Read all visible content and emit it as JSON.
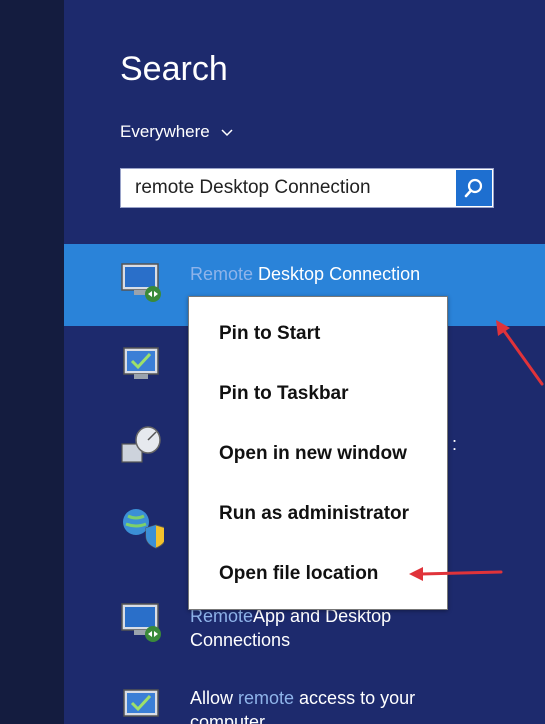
{
  "search": {
    "title": "Search",
    "scope": "Everywhere",
    "query": "remote Desktop Connection"
  },
  "results": [
    {
      "prefix": "Remote",
      "rest": " Desktop Connection",
      "icon": "remote-desktop-icon"
    },
    {
      "line1_highlight": "Remote",
      "line1_rest": "App and Desktop",
      "line2": "Connections",
      "icon": "remoteapp-icon"
    },
    {
      "line1_prefix": "Allow ",
      "line1_highlight": "remote",
      "line1_rest": " access to your",
      "line2": "computer",
      "icon": "system-icon"
    }
  ],
  "context_menu": {
    "items": [
      "Pin to Start",
      "Pin to Taskbar",
      "Open in new window",
      "Run as administrator",
      "Open file location"
    ]
  },
  "colors": {
    "panel": "#1d2a6d",
    "strip": "#141c3f",
    "selected": "#2a83d9",
    "highlight": "#8fb4ea",
    "arrow": "#e0333a"
  }
}
